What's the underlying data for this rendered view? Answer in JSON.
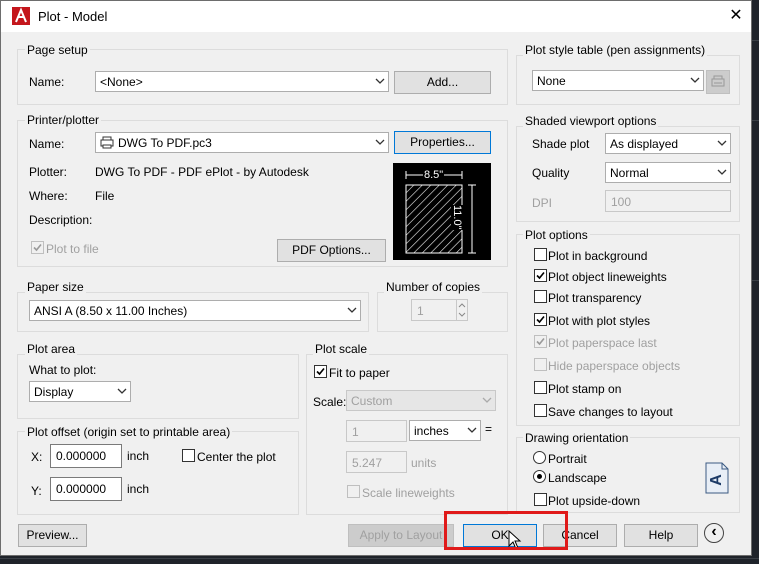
{
  "window": {
    "title": "Plot - Model",
    "close_glyph": "✕"
  },
  "page_setup": {
    "label": "Page setup",
    "name_label": "Name:",
    "name_value": "<None>",
    "add_button": "Add..."
  },
  "printer": {
    "label": "Printer/plotter",
    "name_label": "Name:",
    "name_value": "DWG To PDF.pc3",
    "properties_button": "Properties...",
    "plotter_label": "Plotter:",
    "plotter_value": "DWG To PDF - PDF ePlot - by Autodesk",
    "where_label": "Where:",
    "where_value": "File",
    "description_label": "Description:",
    "plot_to_file_label": "Plot to file",
    "plot_to_file_checked": true,
    "pdf_options_button": "PDF Options...",
    "preview_width": "8.5\"",
    "preview_height": "11.0\""
  },
  "paper_size": {
    "label": "Paper size",
    "value": "ANSI A (8.50 x 11.00 Inches)"
  },
  "copies": {
    "label": "Number of copies",
    "value": "1"
  },
  "plot_area": {
    "label": "Plot area",
    "what_label": "What to plot:",
    "value": "Display"
  },
  "plot_offset": {
    "label": "Plot offset (origin set to printable area)",
    "x_label": "X:",
    "x_value": "0.000000",
    "x_unit": "inch",
    "y_label": "Y:",
    "y_value": "0.000000",
    "y_unit": "inch",
    "center_label": "Center the plot",
    "center_checked": false
  },
  "plot_scale": {
    "label": "Plot scale",
    "fit_label": "Fit to paper",
    "fit_checked": true,
    "scale_label": "Scale:",
    "scale_value": "Custom",
    "value1": "1",
    "unit_value": "inches",
    "equals": "=",
    "value2": "5.247",
    "units_label": "units",
    "lineweights_label": "Scale lineweights",
    "lineweights_checked": false
  },
  "plot_style_table": {
    "label": "Plot style table (pen assignments)",
    "value": "None"
  },
  "shaded_viewport": {
    "label": "Shaded viewport options",
    "shade_label": "Shade plot",
    "shade_value": "As displayed",
    "quality_label": "Quality",
    "quality_value": "Normal",
    "dpi_label": "DPI",
    "dpi_value": "100"
  },
  "plot_options": {
    "label": "Plot options",
    "items": [
      {
        "label": "Plot in background",
        "checked": false,
        "disabled": false
      },
      {
        "label": "Plot object lineweights",
        "checked": true,
        "disabled": false
      },
      {
        "label": "Plot transparency",
        "checked": false,
        "disabled": false
      },
      {
        "label": "Plot with plot styles",
        "checked": true,
        "disabled": false
      },
      {
        "label": "Plot paperspace last",
        "checked": true,
        "disabled": true
      },
      {
        "label": "Hide paperspace objects",
        "checked": false,
        "disabled": true
      },
      {
        "label": "Plot stamp on",
        "checked": false,
        "disabled": false
      },
      {
        "label": "Save changes to layout",
        "checked": false,
        "disabled": false
      }
    ]
  },
  "orientation": {
    "label": "Drawing orientation",
    "portrait_label": "Portrait",
    "landscape_label": "Landscape",
    "selected": "Landscape",
    "upside_down_label": "Plot upside-down",
    "upside_down_checked": false,
    "orientation_icon_letter": "A"
  },
  "footer": {
    "preview_button": "Preview...",
    "apply_button": "Apply to Layout",
    "ok_button": "OK",
    "cancel_button": "Cancel",
    "help_button": "Help",
    "collapse_glyph": "‹"
  },
  "colors": {
    "accent": "#0078d7",
    "highlight": "#e01a1a",
    "dialog_bg": "#f0f0f0"
  }
}
